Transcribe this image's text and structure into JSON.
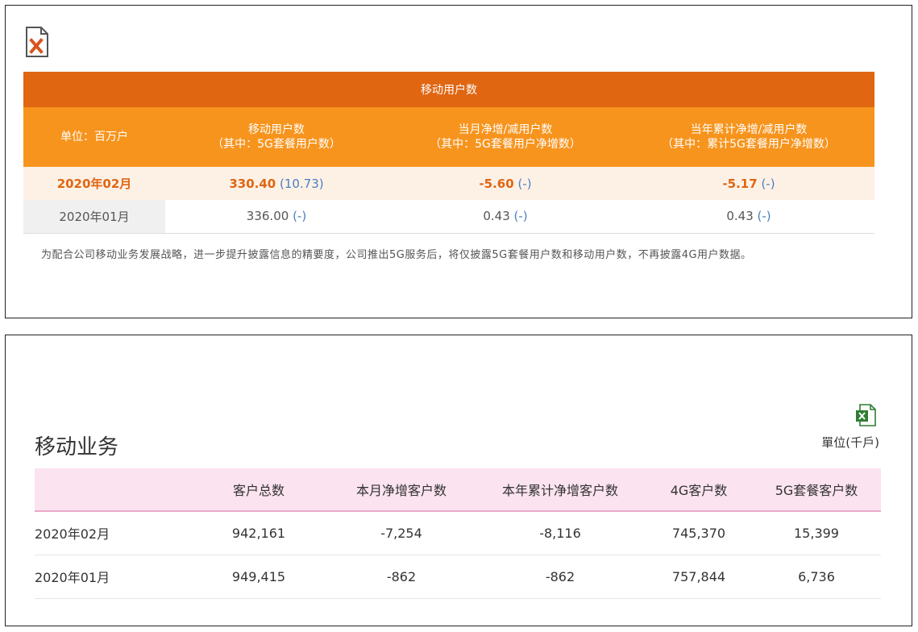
{
  "mobile_panel": {
    "table_title": "移动用户数",
    "header": {
      "unit": "单位：百万户",
      "col1_line1": "移动用户数",
      "col1_line2": "（其中：5G套餐用户数）",
      "col2_line1": "当月净增/减用户数",
      "col2_line2": "（其中：5G套餐用户净增数）",
      "col3_line1": "当年累计净增/减用户数",
      "col3_line2": "（其中：累计5G套餐用户净增数）"
    },
    "rows": [
      {
        "month": "2020年02月",
        "users": "330.40",
        "users_5g": "(10.73)",
        "net_month": "-5.60",
        "net_month_5g": "(-)",
        "net_year": "-5.17",
        "net_year_5g": "(-)"
      },
      {
        "month": "2020年01月",
        "users": "336.00",
        "users_5g": "(-)",
        "net_month": "0.43",
        "net_month_5g": "(-)",
        "net_year": "0.43",
        "net_year_5g": "(-)"
      }
    ],
    "note": "为配合公司移动业务发展战略，进一步提升披露信息的精要度，公司推出5G服务后，将仅披露5G套餐用户数和移动用户数，不再披露4G用户数据。"
  },
  "business_panel": {
    "title": "移动业务",
    "unit": "單位(千戶)",
    "columns": [
      "",
      "客户总数",
      "本月净增客户数",
      "本年累计净增客户数",
      "4G客户数",
      "5G套餐客户数"
    ],
    "rows": [
      {
        "month": "2020年02月",
        "total": "942,161",
        "net_month": "-7,254",
        "net_year": "-8,116",
        "g4": "745,370",
        "g5": "15,399"
      },
      {
        "month": "2020年01月",
        "total": "949,415",
        "net_month": "-862",
        "net_year": "-862",
        "g4": "757,844",
        "g5": "6,736"
      }
    ]
  },
  "colors": {
    "title_bar": "#e06612",
    "header_bar": "#f7941d",
    "highlight_row": "#fdf1e6",
    "pink_header": "#fbe3ef",
    "blue_month": "#3a9fd6",
    "green_month": "#6aa534"
  },
  "icons": [
    "excel-download-icon",
    "excel-export-icon"
  ]
}
